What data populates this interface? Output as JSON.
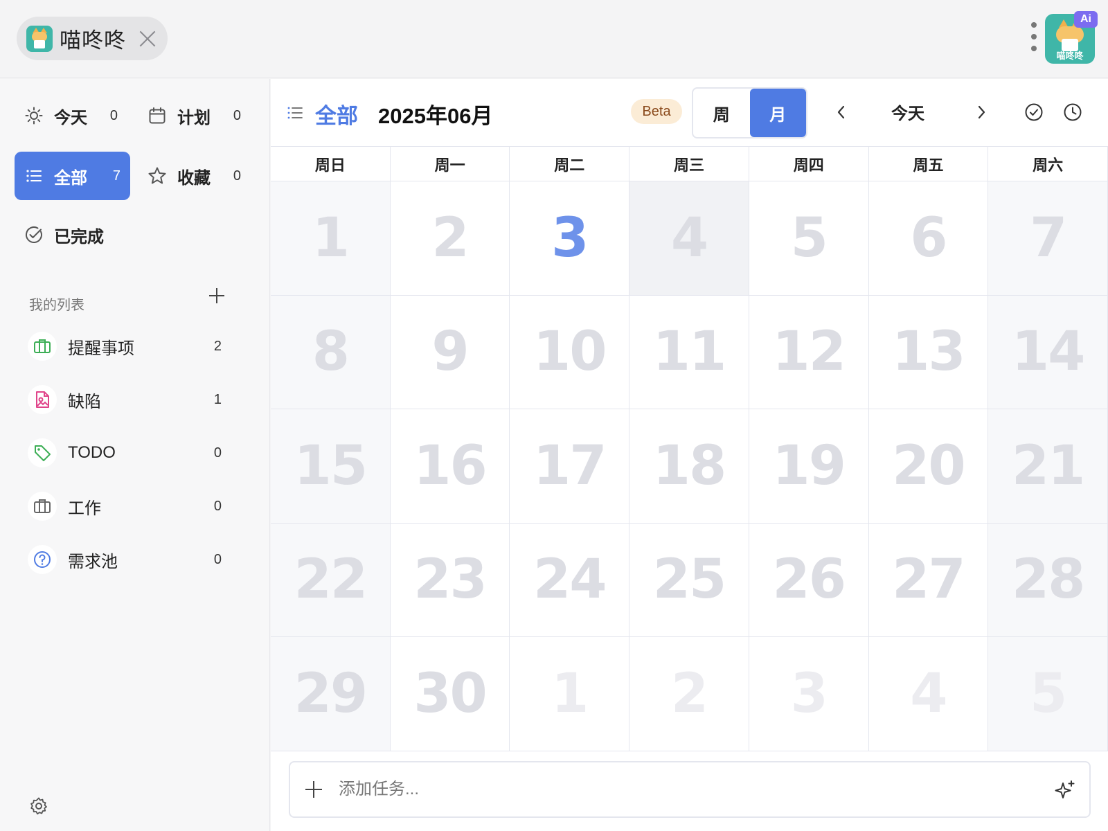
{
  "window": {
    "app_title": "喵咚咚",
    "avatar_name": "喵咚咚",
    "ai_badge": "Ai"
  },
  "sidebar": {
    "smart_lists": [
      {
        "label": "今天",
        "count": "0",
        "icon": "sun-icon"
      },
      {
        "label": "计划",
        "count": "0",
        "icon": "calendar-icon"
      },
      {
        "label": "全部",
        "count": "7",
        "icon": "list-icon",
        "active": true
      },
      {
        "label": "收藏",
        "count": "0",
        "icon": "star-icon"
      },
      {
        "label": "已完成",
        "count": "",
        "icon": "check-circle-icon"
      }
    ],
    "my_lists_title": "我的列表",
    "lists": [
      {
        "label": "提醒事项",
        "count": "2",
        "icon": "briefcase-icon",
        "color": "#3cae55"
      },
      {
        "label": "缺陷",
        "count": "1",
        "icon": "bug-file-icon",
        "color": "#e0448a"
      },
      {
        "label": "TODO",
        "count": "0",
        "icon": "tag-icon",
        "color": "#3cae55"
      },
      {
        "label": "工作",
        "count": "0",
        "icon": "briefcase-icon",
        "color": "#666666"
      },
      {
        "label": "需求池",
        "count": "0",
        "icon": "question-circle-icon",
        "color": "#4f7be3"
      }
    ]
  },
  "header": {
    "list_name": "全部",
    "month": "2025年06月",
    "beta": "Beta",
    "view_week": "周",
    "view_month": "月",
    "today": "今天",
    "active_view": "月"
  },
  "calendar": {
    "weekdays": [
      "周日",
      "周一",
      "周二",
      "周三",
      "周四",
      "周五",
      "周六"
    ],
    "today": 3,
    "weeks": [
      [
        "1",
        "2",
        "3",
        "4",
        "5",
        "6",
        "7"
      ],
      [
        "8",
        "9",
        "10",
        "11",
        "12",
        "13",
        "14"
      ],
      [
        "15",
        "16",
        "17",
        "18",
        "19",
        "20",
        "21"
      ],
      [
        "22",
        "23",
        "24",
        "25",
        "26",
        "27",
        "28"
      ],
      [
        "29",
        "30",
        "1",
        "2",
        "3",
        "4",
        "5"
      ]
    ]
  },
  "add_task": {
    "placeholder": "添加任务..."
  },
  "colors": {
    "accent": "#4f7be3",
    "beta_bg": "#fbecd6",
    "beta_text": "#8a4a1c",
    "ai_badge": "#7b6cf0",
    "teal": "#3fb6a8"
  }
}
